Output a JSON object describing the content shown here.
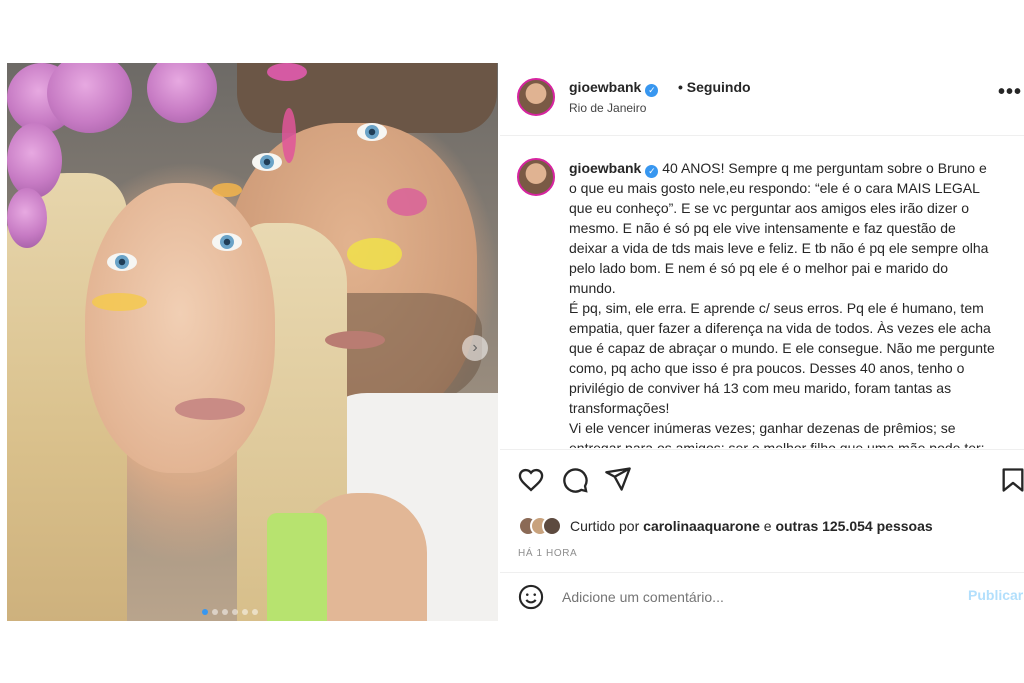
{
  "post": {
    "username": "gioewbank",
    "follow_status": "• Seguindo",
    "location": "Rio de Janeiro",
    "more_label": "•••"
  },
  "caption": {
    "username": "gioewbank",
    "lines": [
      "40 ANOS! Sempre q me perguntam sobre o Bruno e",
      "o que eu mais gosto nele,eu respondo: “ele é o cara MAIS LEGAL",
      "que eu conheço”. E se vc perguntar aos amigos eles irão dizer o",
      "mesmo. E não é só pq ele vive intensamente e faz questão de",
      "deixar a vida de tds mais leve e feliz. E tb não é pq ele sempre olha",
      "pelo lado bom. E nem é só pq ele é o melhor pai e marido do",
      "mundo.",
      "É pq, sim, ele erra. E aprende c/ seus erros. Pq ele é humano, tem",
      "empatia, quer fazer a diferença na vida de todos. Às vezes ele acha",
      "que é capaz de abraçar o mundo. E ele consegue. Não me pergunte",
      "como, pq acho que isso é pra poucos. Desses 40 anos, tenho o",
      "privilégio de conviver há 13 com meu marido, foram tantas as",
      "transformações!",
      "Vi ele vencer inúmeras vezes; ganhar dezenas de prêmios; se",
      "entregar para os amigos; ser o melhor filho que uma mãe pode ter;"
    ]
  },
  "likes": {
    "prefix": "Curtido por",
    "user": "carolinaaquarone",
    "middle": "e",
    "others": "outras 125.054 pessoas"
  },
  "time_ago": "HÁ 1 HORA",
  "comment": {
    "placeholder": "Adicione um comentário...",
    "publish_label": "Publicar"
  },
  "carousel": {
    "next_glyph": "›",
    "current": 1,
    "total": 6
  },
  "colors": {
    "verified": "#3897f0",
    "carousel_active": "#3797f0",
    "publish_disabled": "#b2dffc",
    "story_ring": "#d6249f"
  }
}
